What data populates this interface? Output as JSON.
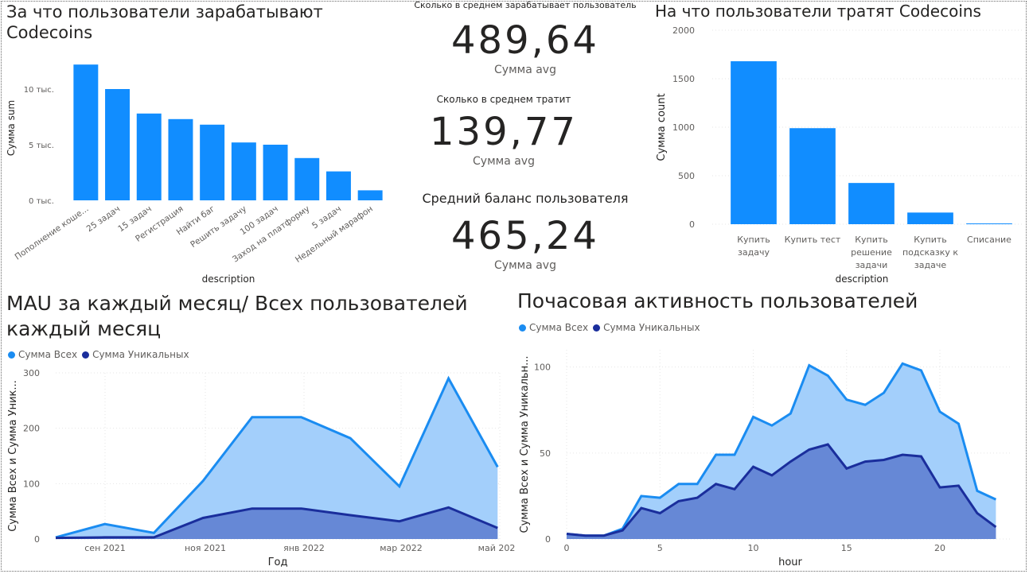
{
  "colors": {
    "bar": "#118dff",
    "area_all": "#a3cffb",
    "line_all": "#1a8cf1",
    "area_uniq": "#6688d6",
    "line_uniq": "#1a2e9c",
    "grid": "#e6e6e6",
    "axis_text": "#605e5c"
  },
  "earn": {
    "title_line1": "За что пользователи зарабатывают",
    "title_line2": "Codecoins",
    "ylabel": "Сумма sum",
    "xlabel": "description",
    "yticks": [
      "0 тыс.",
      "5 тыс.",
      "10 тыс."
    ]
  },
  "kpi": [
    {
      "caption": "Сколько в среднем зарабатывает пользователь",
      "value": "489,64",
      "sub": "Сумма avg"
    },
    {
      "caption": "Сколько в среднем тратит",
      "value": "139,77",
      "sub": "Сумма avg"
    },
    {
      "caption": "Средний баланс пользователя",
      "value": "465,24",
      "sub": "Сумма avg"
    }
  ],
  "spend": {
    "title": "На что пользователи тратят Codecoins",
    "ylabel": "Сумма count",
    "xlabel": "description",
    "yticks": [
      "0",
      "500",
      "1000",
      "1500",
      "2000"
    ]
  },
  "mau": {
    "title_line1": "MAU за каждый месяц/ Всех пользователей",
    "title_line2": "каждый месяц",
    "legend": [
      "Сумма Всех",
      "Сумма Уникальных"
    ],
    "ylabel": "Сумма Всех и Сумма Уник...",
    "xlabel": "Год",
    "yticks": [
      "0",
      "100",
      "200",
      "300"
    ],
    "xticks": [
      "сен 2021",
      "ноя 2021",
      "янв 2022",
      "мар 2022",
      "май 202"
    ]
  },
  "hourly": {
    "title": "Почасовая активность пользователей",
    "legend": [
      "Сумма Всех",
      "Сумма Уникальных"
    ],
    "ylabel": "Сумма Всех и Сумма Уникальн...",
    "xlabel": "hour",
    "yticks": [
      "0",
      "50",
      "100"
    ],
    "xticks": [
      "0",
      "5",
      "10",
      "15",
      "20"
    ]
  },
  "chart_data": [
    {
      "type": "bar",
      "title": "За что пользователи зарабатывают Codecoins",
      "xlabel": "description",
      "ylabel": "Сумма sum",
      "categories": [
        "Пополнение коше...",
        "25 задач",
        "15 задач",
        "Регистрация",
        "Найти баг",
        "Решить задачу",
        "100 задач",
        "Заход на платформу",
        "5 задач",
        "Недельный марафон"
      ],
      "values": [
        12200,
        10000,
        7800,
        7300,
        6800,
        5200,
        5000,
        3800,
        2600,
        900
      ],
      "ylim": [
        0,
        13000
      ]
    },
    {
      "type": "bar",
      "title": "На что пользователи тратят Codecoins",
      "xlabel": "description",
      "ylabel": "Сумма count",
      "categories": [
        "Купить задачу",
        "Купить тест",
        "Купить решение задачи",
        "Купить подсказку к задаче",
        "Списание"
      ],
      "values": [
        1680,
        990,
        425,
        120,
        8
      ],
      "ylim": [
        0,
        2000
      ]
    },
    {
      "type": "area",
      "title": "MAU за каждый месяц/ Всех пользователей каждый месяц",
      "xlabel": "Год",
      "ylabel": "Сумма Всех и Сумма Уник...",
      "x": [
        "2021-07",
        "2021-08",
        "2021-09",
        "2021-10",
        "2021-11",
        "2021-12",
        "2022-01",
        "2022-02",
        "2022-03",
        "2022-04",
        "2022-05"
      ],
      "series": [
        {
          "name": "Сумма Всех",
          "values": [
            3,
            27,
            11,
            105,
            220,
            220,
            182,
            95,
            290,
            130
          ]
        },
        {
          "name": "Сумма Уникальных",
          "values": [
            2,
            3,
            3,
            38,
            55,
            55,
            43,
            32,
            57,
            20
          ]
        }
      ],
      "series_x": [
        "2021-07",
        "2021-08",
        "2021-09",
        "2021-10",
        "2021-11",
        "2021-12",
        "2022-01",
        "2022-02",
        "2022-03",
        "2022-04"
      ],
      "ylim": [
        0,
        300
      ]
    },
    {
      "type": "area",
      "title": "Почасовая активность пользователей",
      "xlabel": "hour",
      "ylabel": "Сумма Всех и Сумма Уникальн...",
      "x": [
        0,
        1,
        2,
        3,
        4,
        5,
        6,
        7,
        8,
        9,
        10,
        11,
        12,
        13,
        14,
        15,
        16,
        17,
        18,
        19,
        20,
        21,
        22,
        23
      ],
      "series": [
        {
          "name": "Сумма Всех",
          "values": [
            3,
            2,
            2,
            6,
            25,
            24,
            32,
            32,
            49,
            49,
            71,
            66,
            73,
            101,
            95,
            81,
            78,
            85,
            102,
            98,
            74,
            67,
            28,
            23
          ]
        },
        {
          "name": "Сумма Уникальных",
          "values": [
            3,
            2,
            2,
            5,
            18,
            15,
            22,
            24,
            32,
            29,
            42,
            37,
            45,
            52,
            55,
            41,
            45,
            46,
            49,
            48,
            30,
            31,
            15,
            7
          ]
        }
      ],
      "ylim": [
        0,
        110
      ]
    }
  ]
}
